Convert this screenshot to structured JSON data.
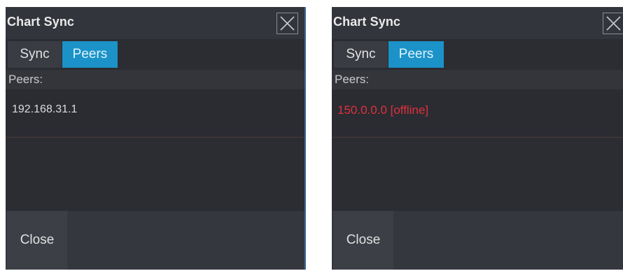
{
  "left_dialog": {
    "title": "Chart Sync",
    "tabs": [
      {
        "label": "Sync",
        "active": false
      },
      {
        "label": "Peers",
        "active": true
      }
    ],
    "peers_label": "Peers:",
    "peer_entry": "192.168.31.1",
    "close_label": "Close"
  },
  "right_dialog": {
    "title": "Chart Sync",
    "tabs": [
      {
        "label": "Sync",
        "active": false
      },
      {
        "label": "Peers",
        "active": true
      }
    ],
    "peers_label": "Peers:",
    "peer_entry": "150.0.0.0 [offline]",
    "close_label": "Close"
  },
  "colors": {
    "dialog_bg": "#2b2d33",
    "active_tab": "#1b93c8",
    "offline_text": "#e0303a"
  },
  "icons": {
    "close": "close-icon"
  }
}
